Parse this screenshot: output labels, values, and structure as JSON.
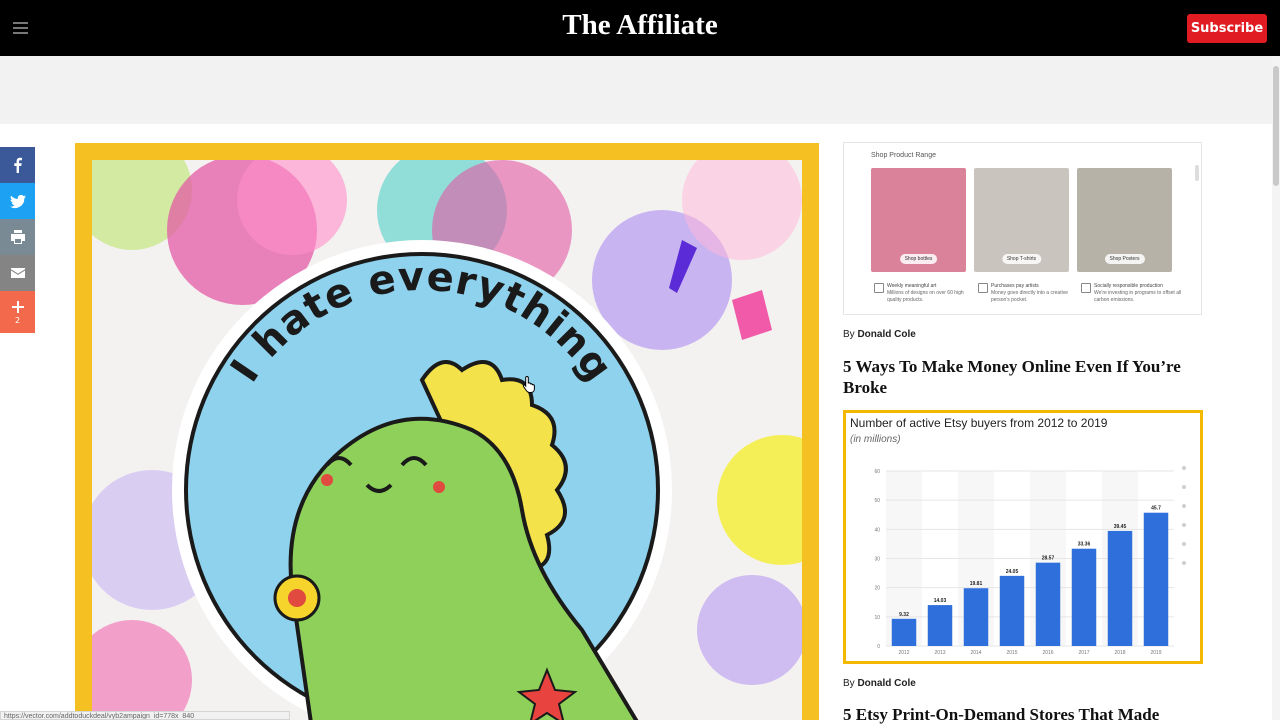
{
  "header": {
    "site_title": "The Affiliate",
    "subscribe_label": "Subscribe"
  },
  "share_bar": {
    "more_count": "2"
  },
  "status_bar": {
    "url": "https://vector.com/addtoduckdeal/vyb2ampaign_id=778x_840"
  },
  "sidebar": {
    "shop_card": {
      "heading": "Shop Product Range",
      "products": [
        {
          "button": "Shop bottles",
          "color": "#d9829a"
        },
        {
          "button": "Shop T-shirts",
          "color": "#c9c4bd"
        },
        {
          "button": "Shop Posters",
          "color": "#b7b2a8"
        }
      ],
      "features": [
        {
          "title": "Weekly meaningful art",
          "text": "Millions of designs on over 60 high quality products."
        },
        {
          "title": "Purchases pay artists",
          "text": "Money goes directly into a creative person's pocket."
        },
        {
          "title": "Socially responsible production",
          "text": "We're investing in programs to offset all carbon emissions."
        }
      ]
    },
    "articles": [
      {
        "by": "By",
        "author": "Donald Cole",
        "title": "5 Ways To Make Money Online Even If You’re Broke"
      },
      {
        "by": "By",
        "author": "Donald Cole",
        "title": "5 Etsy Print-On-Demand Stores That Made"
      }
    ],
    "chart_card": {
      "title": "Number of active Etsy buyers from 2012 to 2019",
      "subtitle": "(in millions)"
    }
  },
  "hero": {
    "sticker_text": "I hate everything"
  },
  "chart_data": {
    "type": "bar",
    "title": "Number of active Etsy buyers from 2012 to 2019",
    "subtitle": "(in millions)",
    "categories": [
      "2012",
      "2013",
      "2014",
      "2015",
      "2016",
      "2017",
      "2018",
      "2019"
    ],
    "values": [
      9.32,
      14.03,
      19.81,
      24.05,
      28.57,
      33.36,
      39.45,
      45.7
    ],
    "ylim": [
      0,
      60
    ],
    "yticks": [
      0,
      10,
      20,
      30,
      40,
      50,
      60
    ],
    "bar_color": "#2f6fdc",
    "grid": true
  },
  "colors": {
    "facebook": "#3b5998",
    "twitter": "#1da1f2",
    "subscribe": "#e11b22",
    "hero_frame": "#f5c022"
  }
}
